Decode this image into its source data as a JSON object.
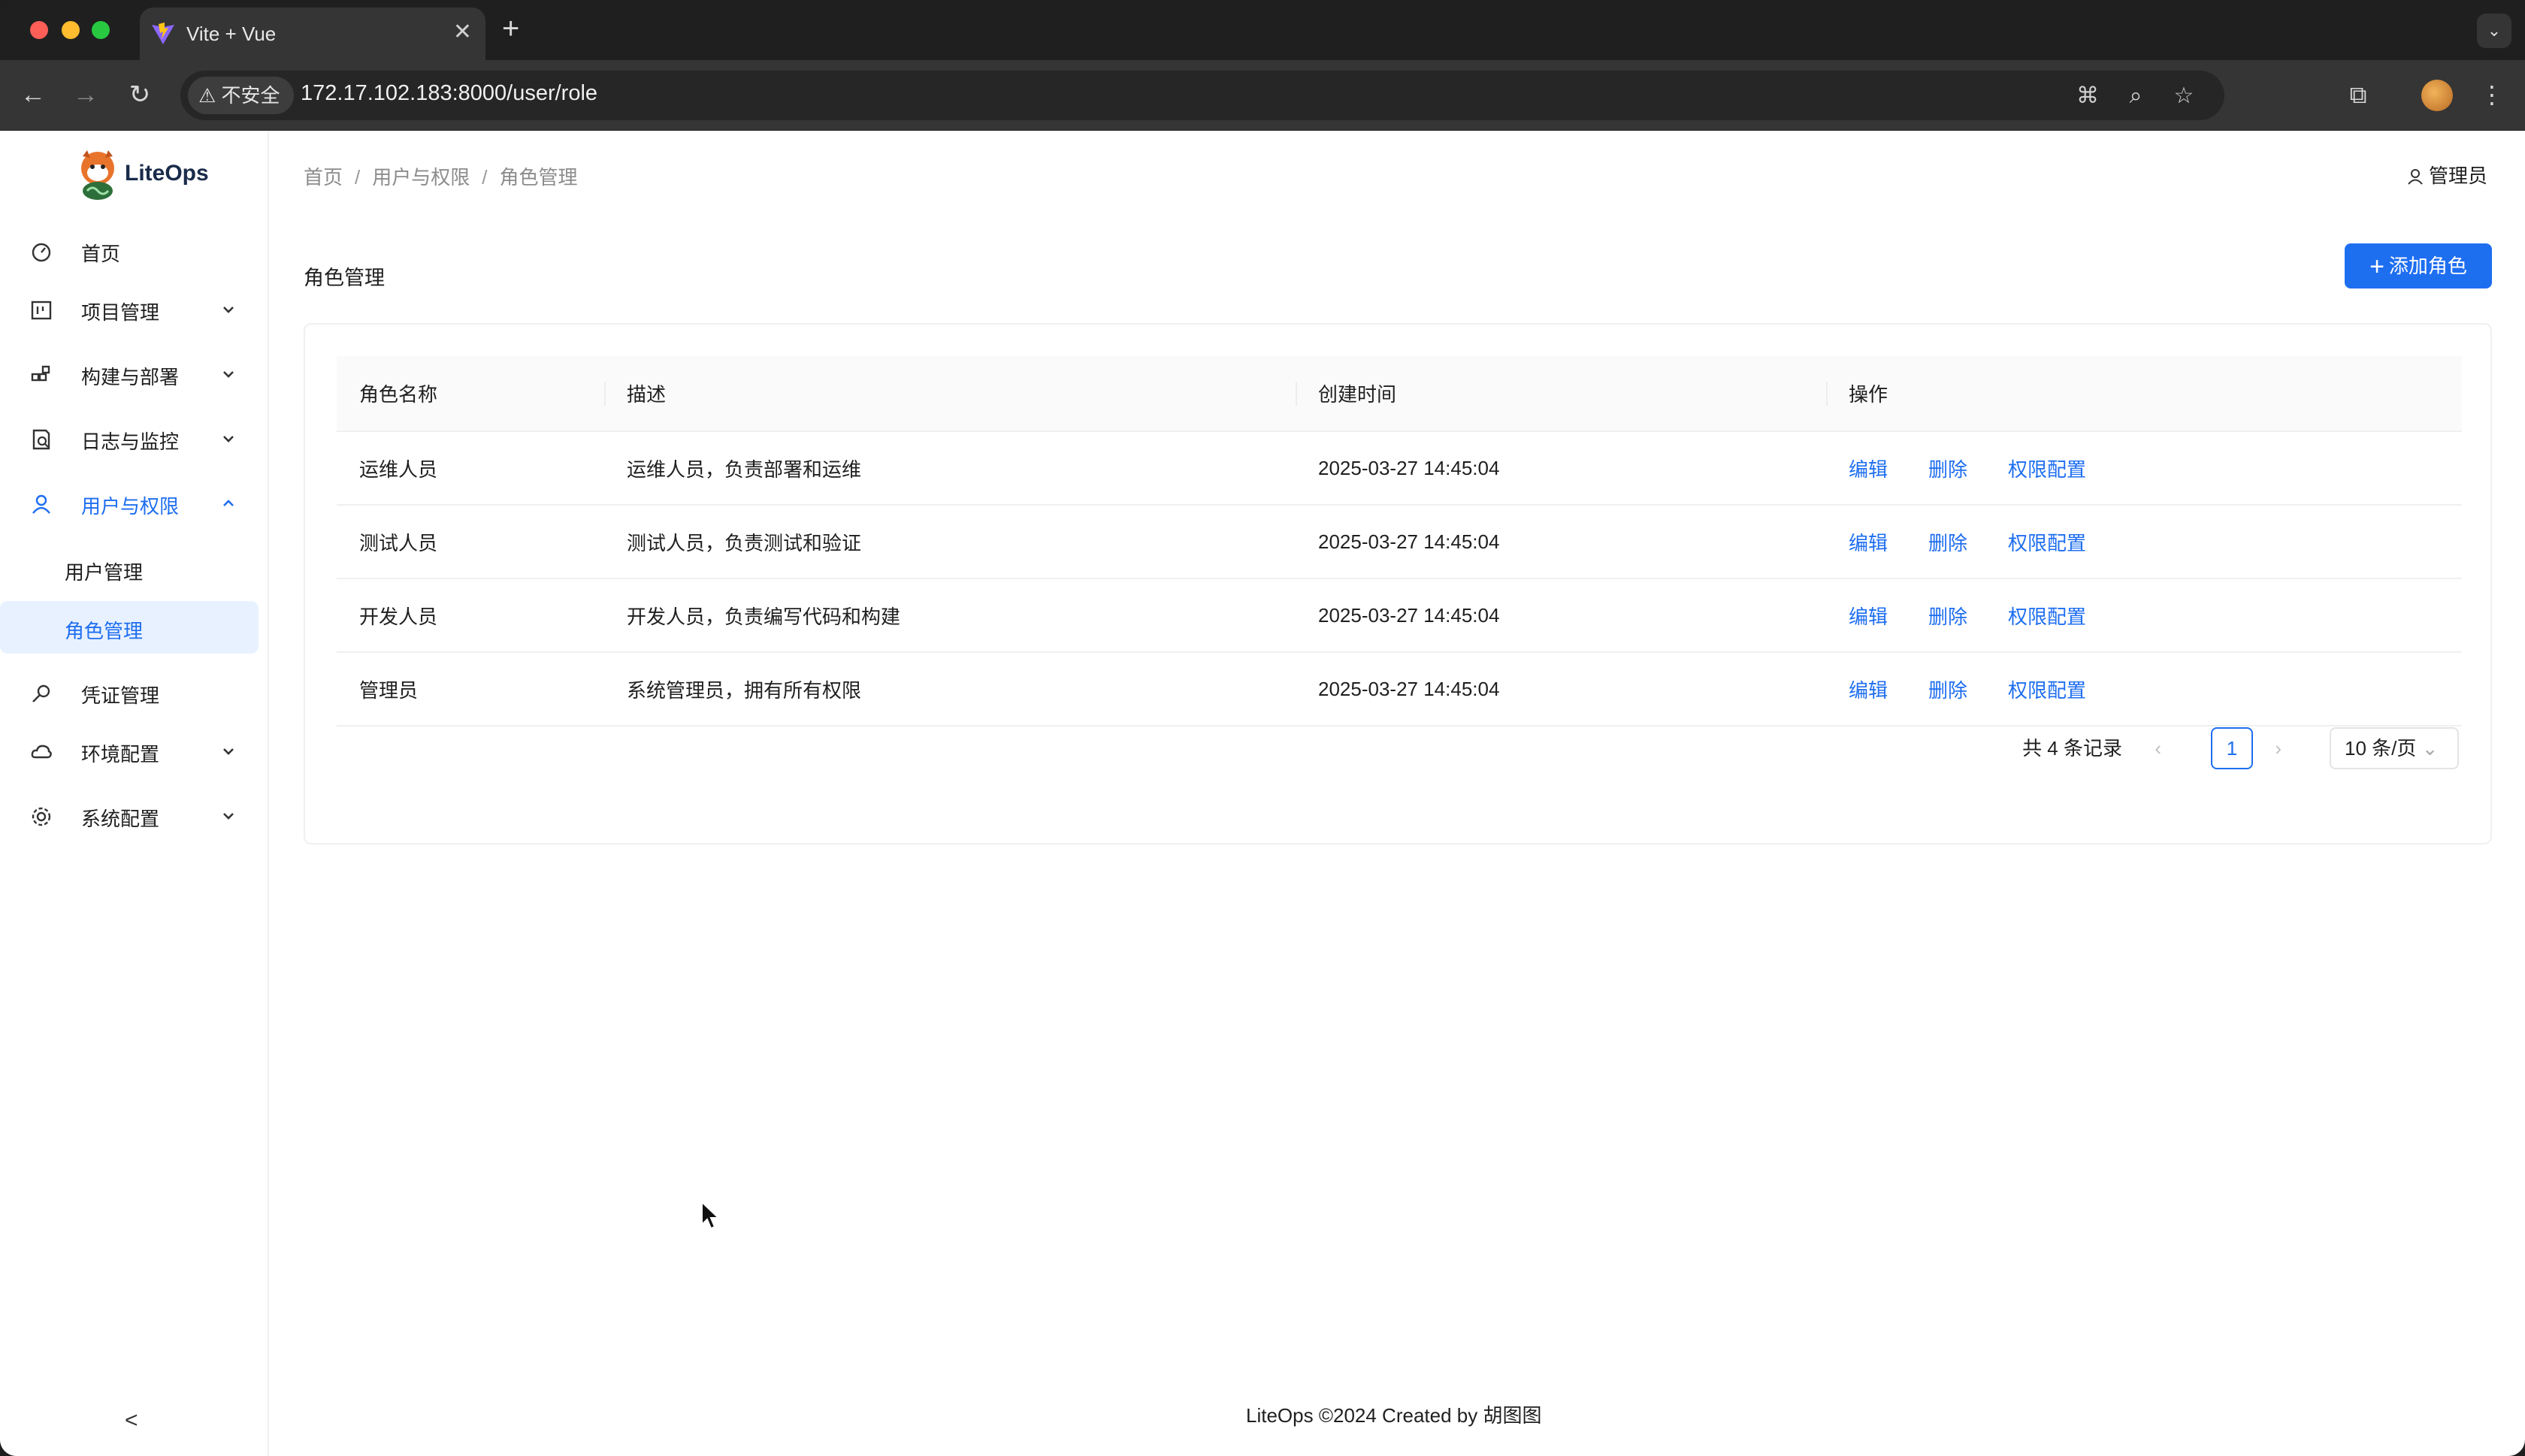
{
  "browser": {
    "tab_title": "Vite + Vue",
    "new_tab_symbol": "+",
    "security_label": "不安全",
    "url": "172.17.102.183:8000/user/role"
  },
  "brand": {
    "name": "LiteOps"
  },
  "sidebar": {
    "items": [
      {
        "label": "首页",
        "icon": "dashboard-icon",
        "expandable": false
      },
      {
        "label": "项目管理",
        "icon": "project-icon",
        "expandable": true
      },
      {
        "label": "构建与部署",
        "icon": "build-icon",
        "expandable": true
      },
      {
        "label": "日志与监控",
        "icon": "log-icon",
        "expandable": true
      },
      {
        "label": "用户与权限",
        "icon": "user-icon",
        "expandable": true,
        "expanded": true
      },
      {
        "label": "凭证管理",
        "icon": "key-icon",
        "expandable": false
      },
      {
        "label": "环境配置",
        "icon": "cloud-icon",
        "expandable": true
      },
      {
        "label": "系统配置",
        "icon": "gear-icon",
        "expandable": true
      }
    ],
    "sub_items": [
      {
        "label": "用户管理"
      },
      {
        "label": "角色管理",
        "selected": true
      }
    ],
    "collapse_symbol": "<"
  },
  "header": {
    "breadcrumb": [
      "首页",
      "用户与权限",
      "角色管理"
    ],
    "separator": "/",
    "user_label": "管理员"
  },
  "main": {
    "title": "角色管理",
    "add_button": "添加角色",
    "table": {
      "columns": [
        "角色名称",
        "描述",
        "创建时间",
        "操作"
      ],
      "rows": [
        {
          "name": "运维人员",
          "desc": "运维人员，负责部署和运维",
          "created": "2025-03-27 14:45:04"
        },
        {
          "name": "测试人员",
          "desc": "测试人员，负责测试和验证",
          "created": "2025-03-27 14:45:04"
        },
        {
          "name": "开发人员",
          "desc": "开发人员，负责编写代码和构建",
          "created": "2025-03-27 14:45:04"
        },
        {
          "name": "管理员",
          "desc": "系统管理员，拥有所有权限",
          "created": "2025-03-27 14:45:04"
        }
      ],
      "actions": [
        "编辑",
        "删除",
        "权限配置"
      ]
    },
    "pagination": {
      "total": "共 4 条记录",
      "current_page": "1",
      "page_size": "10 条/页"
    }
  },
  "footer": {
    "text": "LiteOps ©2024 Created by 胡图图"
  },
  "colors": {
    "accent": "#1e6ef0",
    "selected_bg": "#e8f1ff"
  }
}
